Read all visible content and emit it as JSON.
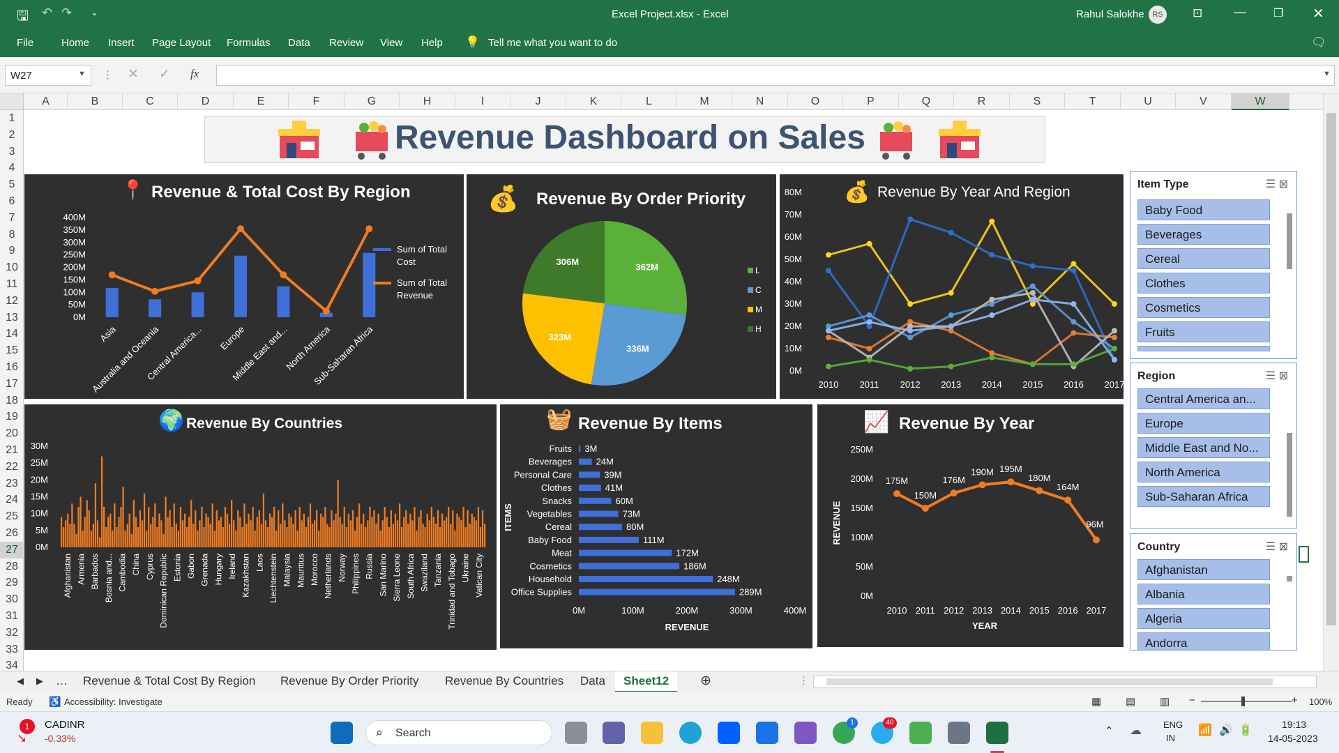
{
  "window": {
    "title": "Excel Project.xlsx  -  Excel",
    "user": "Rahul Salokhe",
    "initials": "RS"
  },
  "ribbon": {
    "tabs": [
      "File",
      "Home",
      "Insert",
      "Page Layout",
      "Formulas",
      "Data",
      "Review",
      "View",
      "Help"
    ],
    "tell": "Tell me what you want to do"
  },
  "formula_bar": {
    "name_box": "W27",
    "fx": "fx",
    "value": ""
  },
  "columns": [
    "A",
    "B",
    "C",
    "D",
    "E",
    "F",
    "G",
    "H",
    "I",
    "J",
    "K",
    "L",
    "M",
    "N",
    "O",
    "P",
    "Q",
    "R",
    "S",
    "T",
    "U",
    "V",
    "W"
  ],
  "rows": [
    "1",
    "2",
    "3",
    "4",
    "5",
    "6",
    "7",
    "8",
    "9",
    "10",
    "11",
    "12",
    "13",
    "14",
    "15",
    "16",
    "17",
    "18",
    "19",
    "20",
    "21",
    "22",
    "23",
    "24",
    "25",
    "26",
    "27",
    "28",
    "29",
    "30",
    "31",
    "32",
    "33",
    "34"
  ],
  "dashboard": {
    "banner": "Revenue Dashboard on Sales"
  },
  "chart_data": [
    {
      "type": "bar",
      "title": "Revenue & Total Cost By Region",
      "categories": [
        "Asia",
        "Australia and Oceania",
        "Central America...",
        "Europe",
        "Middle East and...",
        "North America",
        "Sub-Saharan Africa"
      ],
      "series": [
        {
          "name": "Sum of Total Cost",
          "type": "bar",
          "values": [
            117,
            72,
            100,
            247,
            124,
            18,
            258
          ]
        },
        {
          "name": "Sum of Total Revenue",
          "type": "line",
          "values": [
            170,
            104,
            146,
            355,
            170,
            25,
            355
          ]
        }
      ],
      "y_ticks": [
        "400M",
        "350M",
        "300M",
        "250M",
        "200M",
        "150M",
        "100M",
        "50M",
        "0M"
      ],
      "ylim": [
        0,
        400
      ]
    },
    {
      "type": "pie",
      "title": "Revenue By Order Priority",
      "labels": [
        "L",
        "C",
        "M",
        "H"
      ],
      "values": [
        362,
        336,
        323,
        306
      ],
      "data_labels": [
        "362M",
        "336M",
        "323M",
        "306M"
      ],
      "colors": [
        "#5bb03a",
        "#5b9bd5",
        "#ffc000",
        "#3f7a2b"
      ]
    },
    {
      "type": "line",
      "title": "Revenue By Year And Region",
      "x": [
        "2010",
        "2011",
        "2012",
        "2013",
        "2014",
        "2015",
        "2016",
        "2017"
      ],
      "y_ticks": [
        "80M",
        "70M",
        "60M",
        "50M",
        "40M",
        "30M",
        "20M",
        "10M",
        "0M"
      ],
      "ylim": [
        0,
        80
      ],
      "series": [
        {
          "values": [
            52,
            57,
            30,
            35,
            67,
            30,
            48,
            30
          ],
          "color": "#ffd21f"
        },
        {
          "values": [
            45,
            20,
            68,
            62,
            52,
            47,
            45,
            5
          ],
          "color": "#2e6fd1"
        },
        {
          "values": [
            20,
            25,
            15,
            25,
            30,
            38,
            22,
            10
          ],
          "color": "#5b9bd5"
        },
        {
          "values": [
            15,
            10,
            22,
            18,
            8,
            3,
            17,
            15
          ],
          "color": "#ed7d31"
        },
        {
          "values": [
            18,
            6,
            20,
            20,
            32,
            35,
            2,
            18
          ],
          "color": "#bcbcbc"
        },
        {
          "values": [
            2,
            5,
            1,
            2,
            6,
            3,
            3,
            10
          ],
          "color": "#5bb03a"
        },
        {
          "values": [
            18,
            22,
            18,
            20,
            25,
            32,
            30,
            5
          ],
          "color": "#8fb8f0"
        }
      ]
    },
    {
      "type": "bar",
      "title": "Revenue By Countries",
      "y_ticks": [
        "30M",
        "25M",
        "20M",
        "15M",
        "10M",
        "5M",
        "0M"
      ],
      "ylim": [
        0,
        30
      ],
      "categories": [
        "Afghanistan",
        "Armenia",
        "Barbados",
        "Bosnia and...",
        "Cambodia",
        "China",
        "Cyprus",
        "Dominican Republic",
        "Estonia",
        "Gabon",
        "Grenada",
        "Hungary",
        "Ireland",
        "Kazakhstan",
        "Laos",
        "Liechtenstein",
        "Malaysia",
        "Mauritius",
        "Morocco",
        "Netherlands",
        "Norway",
        "Philippines",
        "Russia",
        "San Marino",
        "Sierra Leone",
        "South Africa",
        "Swaziland",
        "Tanzania",
        "Trinidad and Tobago",
        "Ukraine",
        "Vatican City"
      ],
      "values": [
        9,
        6,
        8,
        10,
        7,
        13,
        7,
        4,
        12,
        15,
        5,
        9,
        14,
        11,
        5,
        7,
        19,
        8,
        3,
        27,
        12,
        6,
        9,
        10,
        5,
        13,
        6,
        9,
        12,
        18,
        5,
        7,
        10,
        4,
        14,
        9,
        6,
        11,
        8,
        16,
        5,
        12,
        7,
        9,
        13,
        6,
        10,
        8,
        4,
        15,
        9,
        11,
        6,
        13,
        7,
        5,
        12,
        8,
        10,
        6,
        9,
        14,
        7,
        11,
        5,
        8,
        12,
        6,
        10,
        9,
        7,
        13,
        5,
        11,
        8,
        9,
        6,
        12,
        10,
        7,
        14,
        8,
        5,
        11,
        9,
        6,
        13,
        7,
        10,
        8,
        12,
        5,
        9,
        11,
        7,
        16,
        8,
        6,
        10,
        9,
        12,
        5,
        11,
        7,
        13,
        8,
        6,
        10,
        9,
        7,
        11,
        5,
        12,
        8,
        10,
        6,
        9,
        13,
        7,
        8,
        11,
        5,
        10,
        9,
        12,
        7,
        6,
        11,
        8,
        10,
        20,
        9,
        7,
        12,
        6,
        10,
        8,
        11,
        5,
        9,
        13,
        7,
        10,
        6,
        8,
        12,
        9,
        11,
        7,
        10,
        5,
        8,
        12,
        9,
        6,
        11,
        7,
        10,
        8,
        13,
        6,
        9,
        11,
        7,
        10,
        8,
        12,
        5,
        9,
        11,
        7,
        6,
        10,
        8,
        12,
        9,
        7,
        11,
        6,
        10,
        8,
        9,
        12,
        7,
        11,
        5,
        10,
        9,
        8,
        12,
        6,
        11,
        7,
        10,
        9,
        8,
        12,
        6,
        11,
        7
      ]
    },
    {
      "type": "bar",
      "title": "Revenue By Items",
      "orientation": "horizontal",
      "categories": [
        "Fruits",
        "Beverages",
        "Personal Care",
        "Clothes",
        "Snacks",
        "Vegetables",
        "Cereal",
        "Baby Food",
        "Meat",
        "Cosmetics",
        "Household",
        "Office Supplies"
      ],
      "values": [
        3,
        24,
        39,
        41,
        60,
        73,
        80,
        111,
        172,
        186,
        248,
        289
      ],
      "data_labels": [
        "3M",
        "24M",
        "39M",
        "41M",
        "60M",
        "73M",
        "80M",
        "111M",
        "172M",
        "186M",
        "248M",
        "289M"
      ],
      "x_ticks": [
        "0M",
        "100M",
        "200M",
        "300M",
        "400M"
      ],
      "xlim": [
        0,
        400
      ],
      "xlabel": "REVENUE",
      "ylabel": "ITEMS"
    },
    {
      "type": "line",
      "title": "Revenue By Year",
      "x": [
        "2010",
        "2011",
        "2012",
        "2013",
        "2014",
        "2015",
        "2016",
        "2017"
      ],
      "values": [
        175,
        150,
        176,
        190,
        195,
        180,
        164,
        96
      ],
      "data_labels": [
        "175M",
        "150M",
        "176M",
        "190M",
        "195M",
        "180M",
        "164M",
        "96M"
      ],
      "y_ticks": [
        "250M",
        "200M",
        "150M",
        "100M",
        "50M",
        "0M"
      ],
      "ylim": [
        0,
        250
      ],
      "xlabel": "YEAR",
      "ylabel": "REVENUE"
    }
  ],
  "slicers": {
    "item_type": {
      "title": "Item Type",
      "items": [
        "Baby Food",
        "Beverages",
        "Cereal",
        "Clothes",
        "Cosmetics",
        "Fruits"
      ]
    },
    "region": {
      "title": "Region",
      "items": [
        "Central America an...",
        "Europe",
        "Middle East and No...",
        "North America",
        "Sub-Saharan Africa"
      ]
    },
    "country": {
      "title": "Country",
      "items": [
        "Afghanistan",
        "Albania",
        "Algeria",
        "Andorra"
      ]
    }
  },
  "sheet_tabs": [
    "Revenue & Total Cost By Region",
    "Revenue By Order Priority",
    "Revenue By Countries",
    "Data",
    "Sheet12"
  ],
  "status": {
    "ready": "Ready",
    "accessibility": "Accessibility: Investigate",
    "zoom": "100%"
  },
  "taskbar": {
    "ticker": "CADINR",
    "change": "-0.33%",
    "search": "Search",
    "lang1": "ENG",
    "lang2": "IN",
    "time": "19:13",
    "date": "14-05-2023",
    "badge": "1",
    "chrome_badge": "1",
    "telegram_badge": "40"
  }
}
